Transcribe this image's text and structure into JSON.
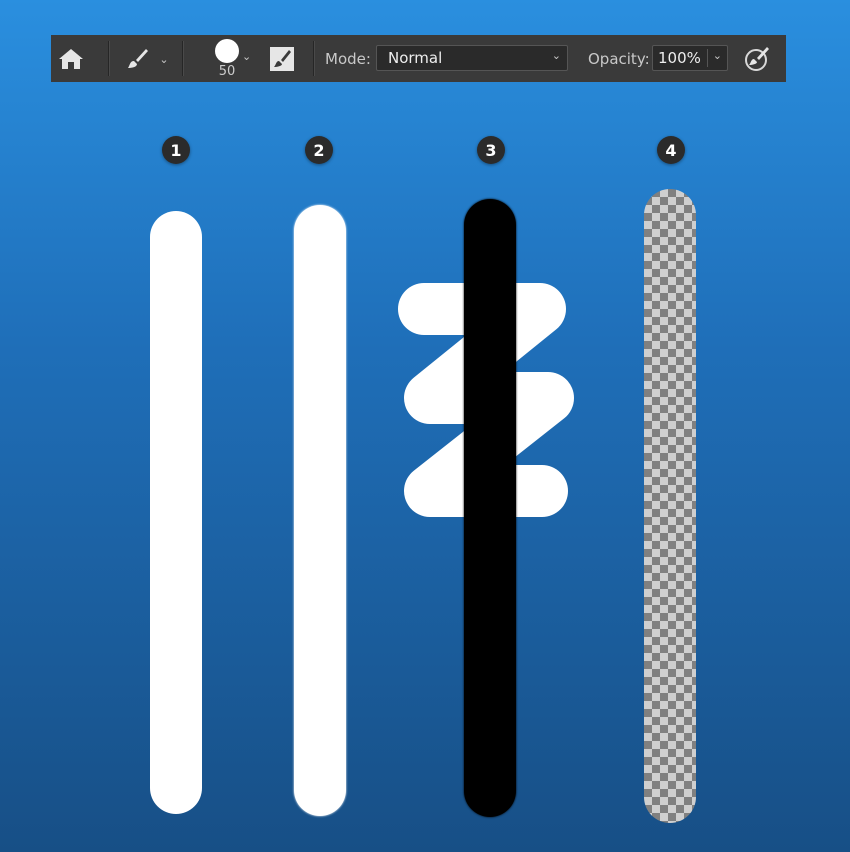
{
  "toolbar": {
    "home_icon": "home-icon",
    "tool_icon": "brush-icon",
    "brush_size": "50",
    "brush_settings_icon": "brush-settings-icon",
    "mode_label": "Mode:",
    "mode_value": "Normal",
    "opacity_label": "Opacity:",
    "opacity_value": "100%",
    "airbrush_icon": "airbrush-icon"
  },
  "badges": [
    "1",
    "2",
    "3",
    "4"
  ],
  "colors": {
    "toolbar_bg": "#3a3a3a",
    "canvas_top": "#2a8fdf",
    "canvas_bottom": "#174f86",
    "stroke_white": "#ffffff",
    "stroke_black": "#000000"
  }
}
